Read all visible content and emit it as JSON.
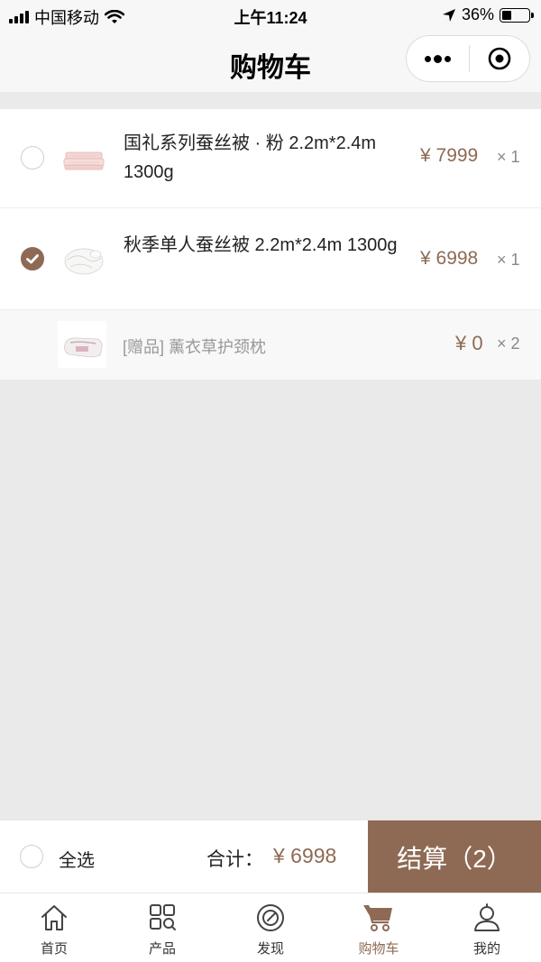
{
  "status_bar": {
    "carrier": "中国移动",
    "time": "上午11:24",
    "battery": "36%",
    "battery_level": 0.36
  },
  "nav": {
    "title": "购物车"
  },
  "cart": {
    "items": [
      {
        "name": "国礼系列蚕丝被 · 粉 2.2m*2.4m 1300g",
        "price": "¥ 7999",
        "qty": "× 1",
        "checked": false
      },
      {
        "name": "秋季单人蚕丝被 2.2m*2.4m 1300g",
        "price": "¥ 6998",
        "qty": "× 1",
        "checked": true
      }
    ],
    "gift": {
      "name": "[赠品] 薰衣草护颈枕",
      "price": "¥ 0",
      "qty": "× 2"
    }
  },
  "checkout": {
    "select_all": "全选",
    "total_label": "合计：",
    "total_value": "¥ 6998",
    "settle": "结算（2）"
  },
  "tabs": [
    {
      "label": "首页",
      "icon": "home-icon"
    },
    {
      "label": "产品",
      "icon": "grid-search-icon"
    },
    {
      "label": "发现",
      "icon": "compass-icon"
    },
    {
      "label": "购物车",
      "icon": "cart-icon",
      "active": true
    },
    {
      "label": "我的",
      "icon": "user-icon"
    }
  ],
  "colors": {
    "accent": "#8e6a55",
    "background": "#eaeaea"
  }
}
